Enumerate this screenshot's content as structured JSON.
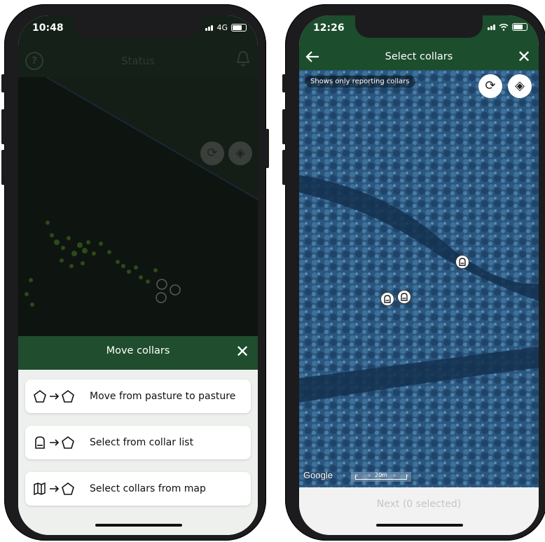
{
  "left_phone": {
    "status_bar": {
      "time": "10:48",
      "network": "4G"
    },
    "top_bar": {
      "title": "Status"
    },
    "sheet": {
      "title": "Move collars",
      "options": [
        {
          "label": "Move from pasture to pasture",
          "icon": "pentagon-to-pentagon-icon"
        },
        {
          "label": "Select from collar list",
          "icon": "collar-to-pentagon-icon"
        },
        {
          "label": "Select collars from map",
          "icon": "map-to-pentagon-icon"
        }
      ]
    }
  },
  "right_phone": {
    "status_bar": {
      "time": "12:26"
    },
    "header": {
      "title": "Select collars"
    },
    "map": {
      "info_pill": "Shows only reporting collars",
      "attribution": "Google",
      "scale_label": "20m"
    },
    "footer": {
      "next_label": "Next (0 selected)"
    }
  },
  "colors": {
    "brand_green": "#1f4d2e",
    "dark_overlay": "#0e1510",
    "disabled_text": "#c6c6c6"
  }
}
